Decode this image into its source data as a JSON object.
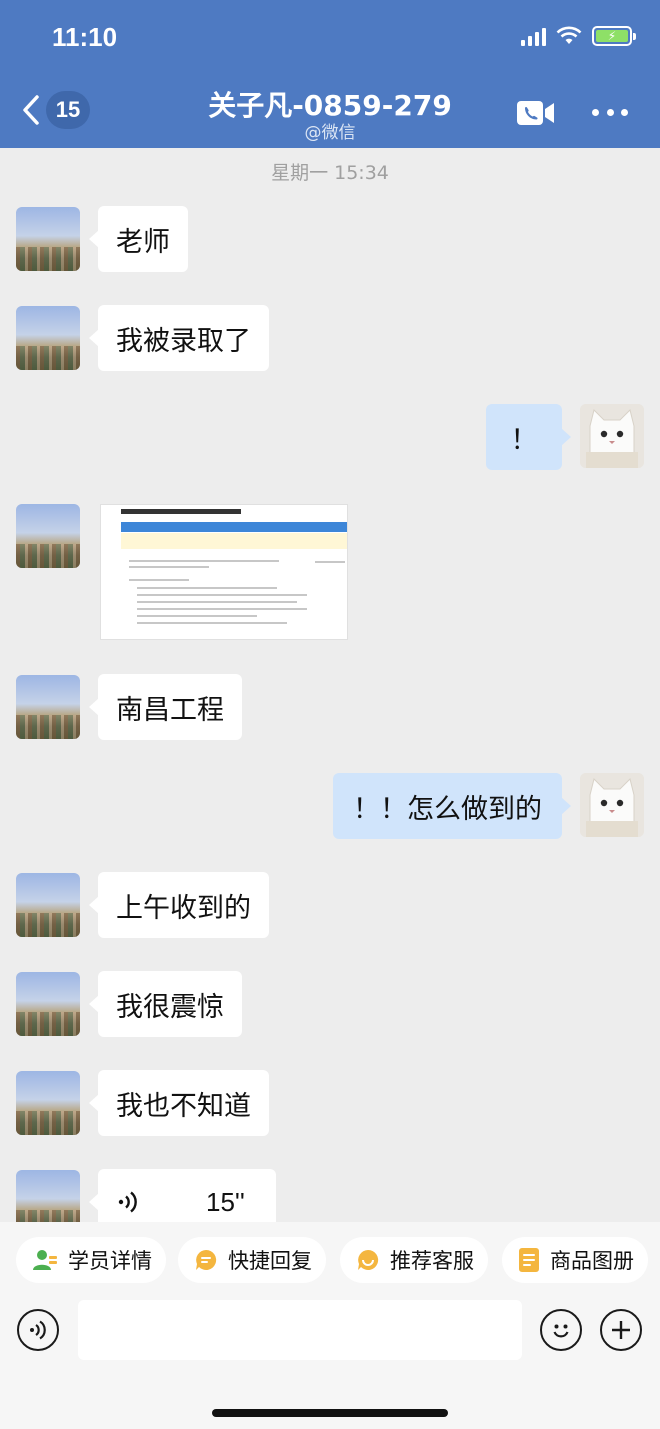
{
  "status": {
    "time": "11:10"
  },
  "header": {
    "back_icon": "chevron-left-icon",
    "unread_count": "15",
    "title": "关子凡-0859-279",
    "subtitle": "@微信",
    "call_icon": "video-call-icon",
    "more_icon": "more-dots-icon"
  },
  "chat": {
    "timestamp": "星期一 15:34",
    "messages": [
      {
        "side": "left",
        "type": "text",
        "text": "老师"
      },
      {
        "side": "left",
        "type": "text",
        "text": "我被录取了"
      },
      {
        "side": "right",
        "type": "text",
        "text": "！"
      },
      {
        "side": "left",
        "type": "image",
        "text": ""
      },
      {
        "side": "left",
        "type": "text",
        "text": "南昌工程"
      },
      {
        "side": "right",
        "type": "text",
        "text": "！！怎么做到的"
      },
      {
        "side": "left",
        "type": "text",
        "text": "上午收到的"
      },
      {
        "side": "left",
        "type": "text",
        "text": "我很震惊"
      },
      {
        "side": "left",
        "type": "text",
        "text": "我也不知道"
      },
      {
        "side": "left",
        "type": "voice",
        "text": "15''"
      }
    ]
  },
  "quick_actions": [
    {
      "label": "学员详情",
      "icon": "person-card-icon"
    },
    {
      "label": "快捷回复",
      "icon": "quick-reply-icon"
    },
    {
      "label": "推荐客服",
      "icon": "service-icon"
    },
    {
      "label": "商品图册",
      "icon": "catalog-icon"
    }
  ],
  "input": {
    "placeholder": "",
    "voice_icon": "voice-input-icon",
    "emoji_icon": "emoji-icon",
    "plus_icon": "plus-icon"
  },
  "colors": {
    "header_bg": "#4e7ac2",
    "chat_bg": "#ededed",
    "bubble_self": "#d0e4fb",
    "bubble_other": "#ffffff"
  }
}
